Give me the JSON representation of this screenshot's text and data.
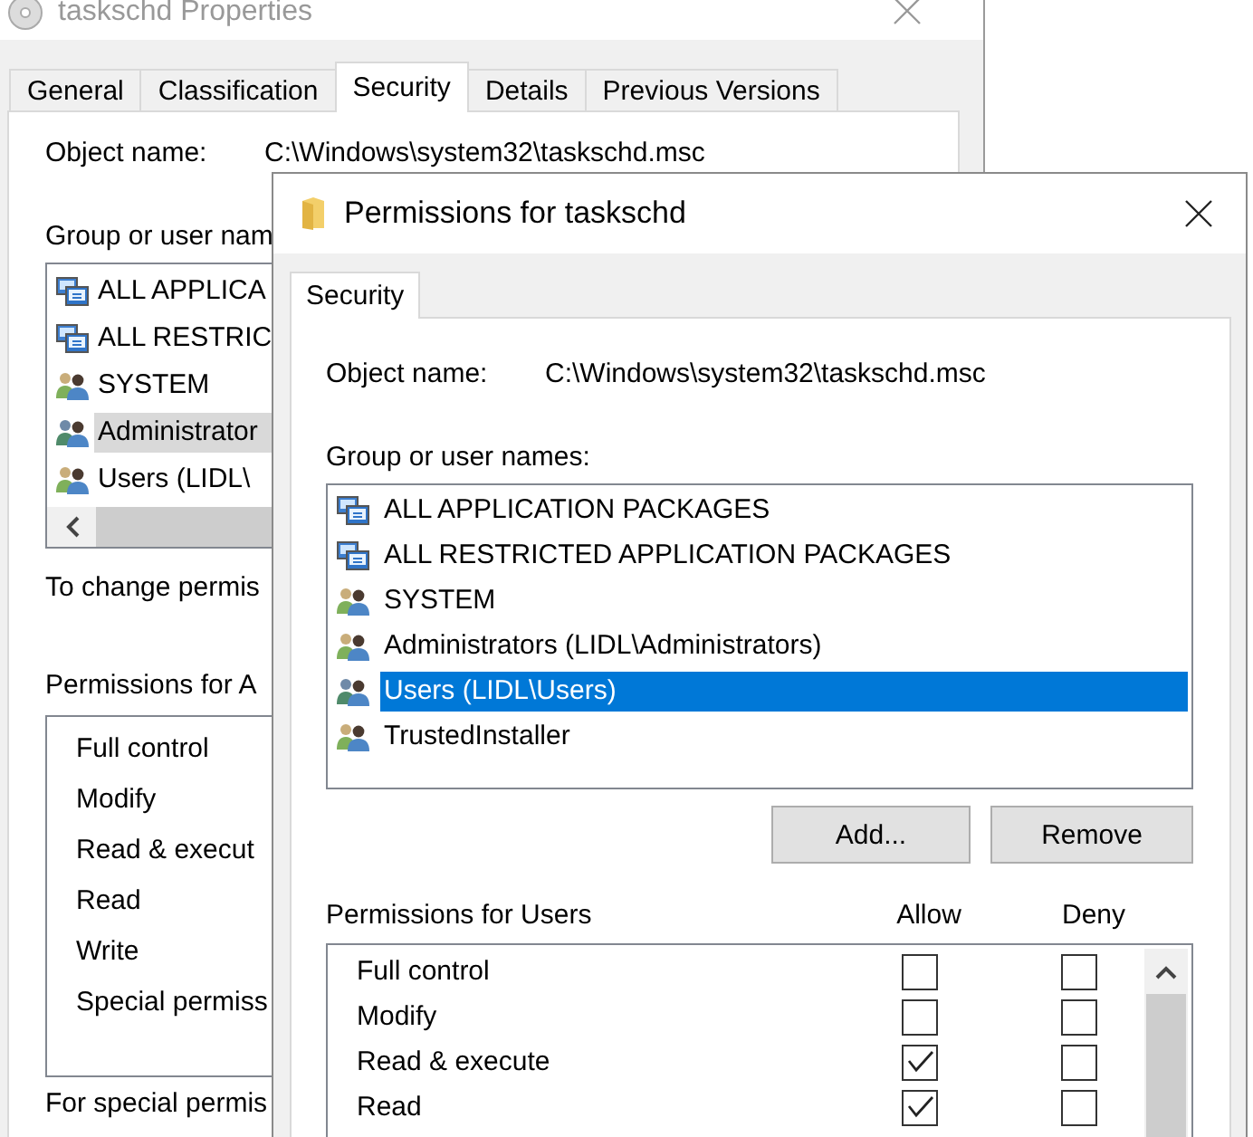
{
  "back_window": {
    "title": "taskschd Properties",
    "tabs": [
      {
        "label": "General",
        "selected": false
      },
      {
        "label": "Classification",
        "selected": false
      },
      {
        "label": "Security",
        "selected": true
      },
      {
        "label": "Details",
        "selected": false
      },
      {
        "label": "Previous Versions",
        "selected": false
      }
    ],
    "object_name_label": "Object name:",
    "object_name": "C:\\Windows\\system32\\taskschd.msc",
    "group_label": "Group or user nam",
    "principals": [
      {
        "name": "ALL APPLICA",
        "kind": "package",
        "selected": false
      },
      {
        "name": "ALL RESTRIC",
        "kind": "package",
        "selected": false
      },
      {
        "name": "SYSTEM",
        "kind": "user",
        "selected": false
      },
      {
        "name": "Administrator",
        "kind": "user",
        "selected": true
      },
      {
        "name": "Users (LIDL\\",
        "kind": "user",
        "selected": false
      }
    ],
    "change_hint": "To change permis",
    "permissions_label": "Permissions for A",
    "permissions": [
      "Full control",
      "Modify",
      "Read & execut",
      "Read",
      "Write",
      "Special permiss"
    ],
    "special_hint": "For special permis"
  },
  "dialog": {
    "title": "Permissions for taskschd",
    "tabs": [
      {
        "label": "Security",
        "selected": true
      }
    ],
    "object_name_label": "Object name:",
    "object_name": "C:\\Windows\\system32\\taskschd.msc",
    "group_label": "Group or user names:",
    "principals": [
      {
        "name": "ALL APPLICATION PACKAGES",
        "kind": "package",
        "selected": false
      },
      {
        "name": "ALL RESTRICTED APPLICATION PACKAGES",
        "kind": "package",
        "selected": false
      },
      {
        "name": "SYSTEM",
        "kind": "user",
        "selected": false
      },
      {
        "name": "Administrators (LIDL\\Administrators)",
        "kind": "user",
        "selected": false
      },
      {
        "name": "Users (LIDL\\Users)",
        "kind": "user",
        "selected": true
      },
      {
        "name": "TrustedInstaller",
        "kind": "user",
        "selected": false
      }
    ],
    "buttons": [
      "Add...",
      "Remove"
    ],
    "permissions_label": "Permissions for Users",
    "allow_header": "Allow",
    "deny_header": "Deny",
    "permissions": [
      {
        "name": "Full control",
        "allow": false,
        "deny": false
      },
      {
        "name": "Modify",
        "allow": false,
        "deny": false
      },
      {
        "name": "Read & execute",
        "allow": true,
        "deny": false
      },
      {
        "name": "Read",
        "allow": true,
        "deny": false
      }
    ]
  }
}
